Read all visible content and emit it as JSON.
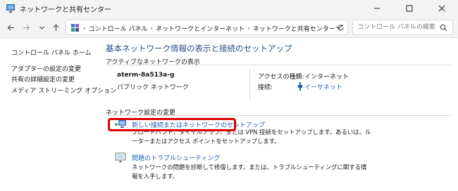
{
  "window": {
    "title": "ネットワークと共有センター"
  },
  "navigation": {
    "breadcrumbs": [
      "コントロール パネル",
      "ネットワークとインターネット",
      "ネットワークと共有センター"
    ],
    "search_placeholder": "コントロール パネルの検索"
  },
  "sidebar": {
    "items": [
      {
        "label": "コントロール パネル ホーム"
      },
      {
        "label": "アダプターの設定の変更"
      },
      {
        "label": "共有の詳細設定の変更"
      },
      {
        "label": "メディア ストリーミング オプション"
      }
    ]
  },
  "main": {
    "title": "基本ネットワーク情報の表示と接続のセットアップ",
    "active_networks_heading": "アクティブなネットワークの表示",
    "network": {
      "name": "aterm-8a513a-g",
      "category": "パブリック ネットワーク",
      "access_type_label": "アクセスの種類:",
      "access_type_value": "インターネット",
      "connection_label": "接続:",
      "connection_value": "イーサネット"
    },
    "change_settings_heading": "ネットワーク設定の変更",
    "tasks": [
      {
        "link": "新しい接続またはネットワークのセットアップ",
        "description": "ブロードバンド、ダイヤルアップ、または VPN 接続をセットアップします。あるいは、ルーターまたはアクセス ポイントをセットアップします。"
      },
      {
        "link": "問題のトラブルシューティング",
        "description": "ネットワークの問題を診断して修復します。または、トラブルシューティングに関する情報を入手します。"
      }
    ]
  },
  "colors": {
    "link": "#1a5fb4",
    "title": "#1f4f8a",
    "highlight": "#e00000"
  }
}
